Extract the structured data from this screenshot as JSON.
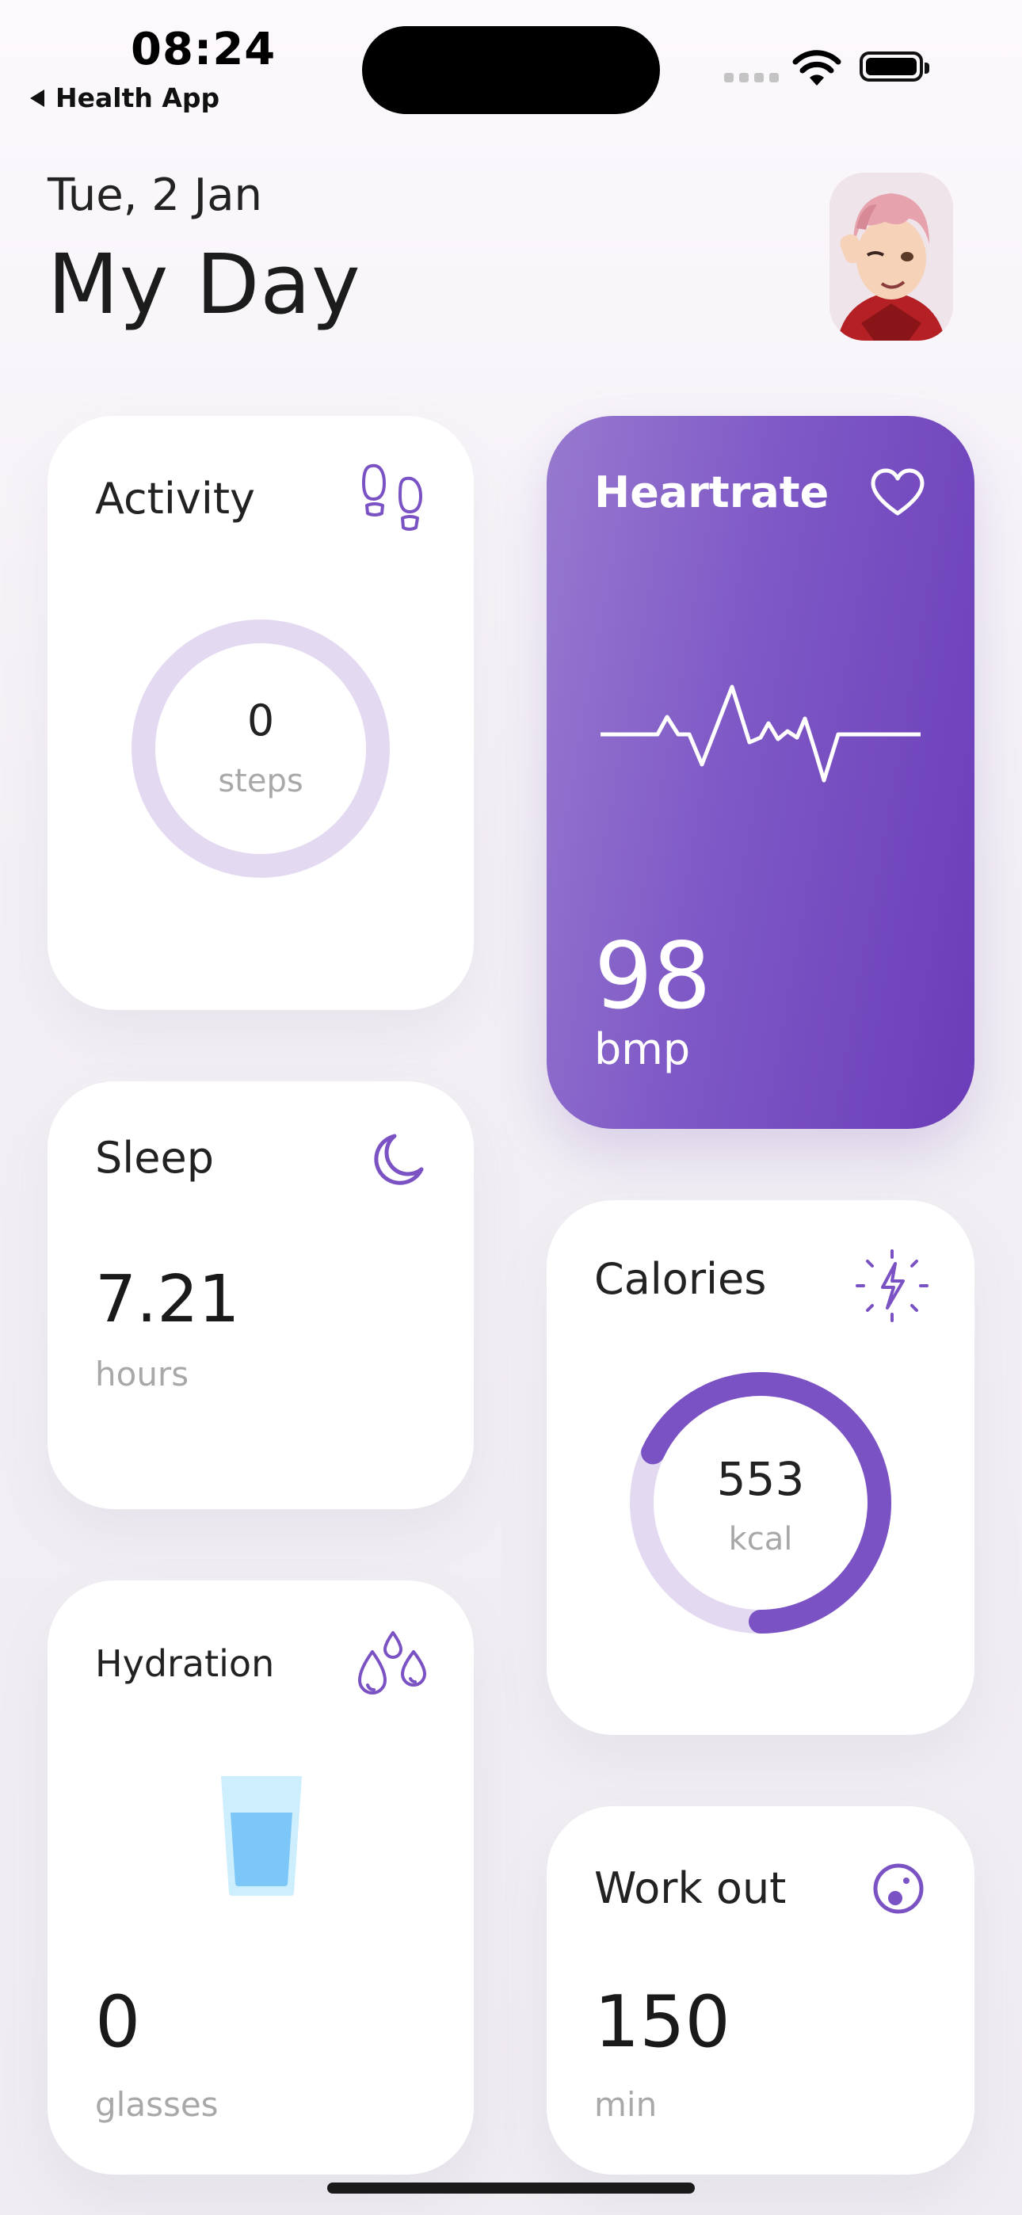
{
  "status_bar": {
    "time": "08:24",
    "back_app": "Health App"
  },
  "header": {
    "date": "Tue, 2 Jan",
    "title": "My Day"
  },
  "cards": {
    "activity": {
      "label": "Activity",
      "value": "0",
      "unit": "steps",
      "icon": "footprints-icon"
    },
    "heartrate": {
      "label": "Heartrate",
      "value": "98",
      "unit": "bmp",
      "icon": "heart-icon"
    },
    "sleep": {
      "label": "Sleep",
      "value": "7.21",
      "unit": "hours",
      "icon": "moon-icon"
    },
    "calories": {
      "label": "Calories",
      "value": "553",
      "unit": "kcal",
      "icon": "energy-bolt-icon",
      "progress_fraction": 0.68
    },
    "hydration": {
      "label": "Hydration",
      "value": "0",
      "unit": "glasses",
      "icon": "water-drops-icon"
    },
    "workout": {
      "label": "Work out",
      "value": "150",
      "unit": "min",
      "icon": "workout-icon"
    }
  },
  "colors": {
    "accent": "#7a52c4",
    "ring_track": "#e3daf2",
    "muted_text": "#a8a8a8",
    "water": "#7cc7f7"
  }
}
